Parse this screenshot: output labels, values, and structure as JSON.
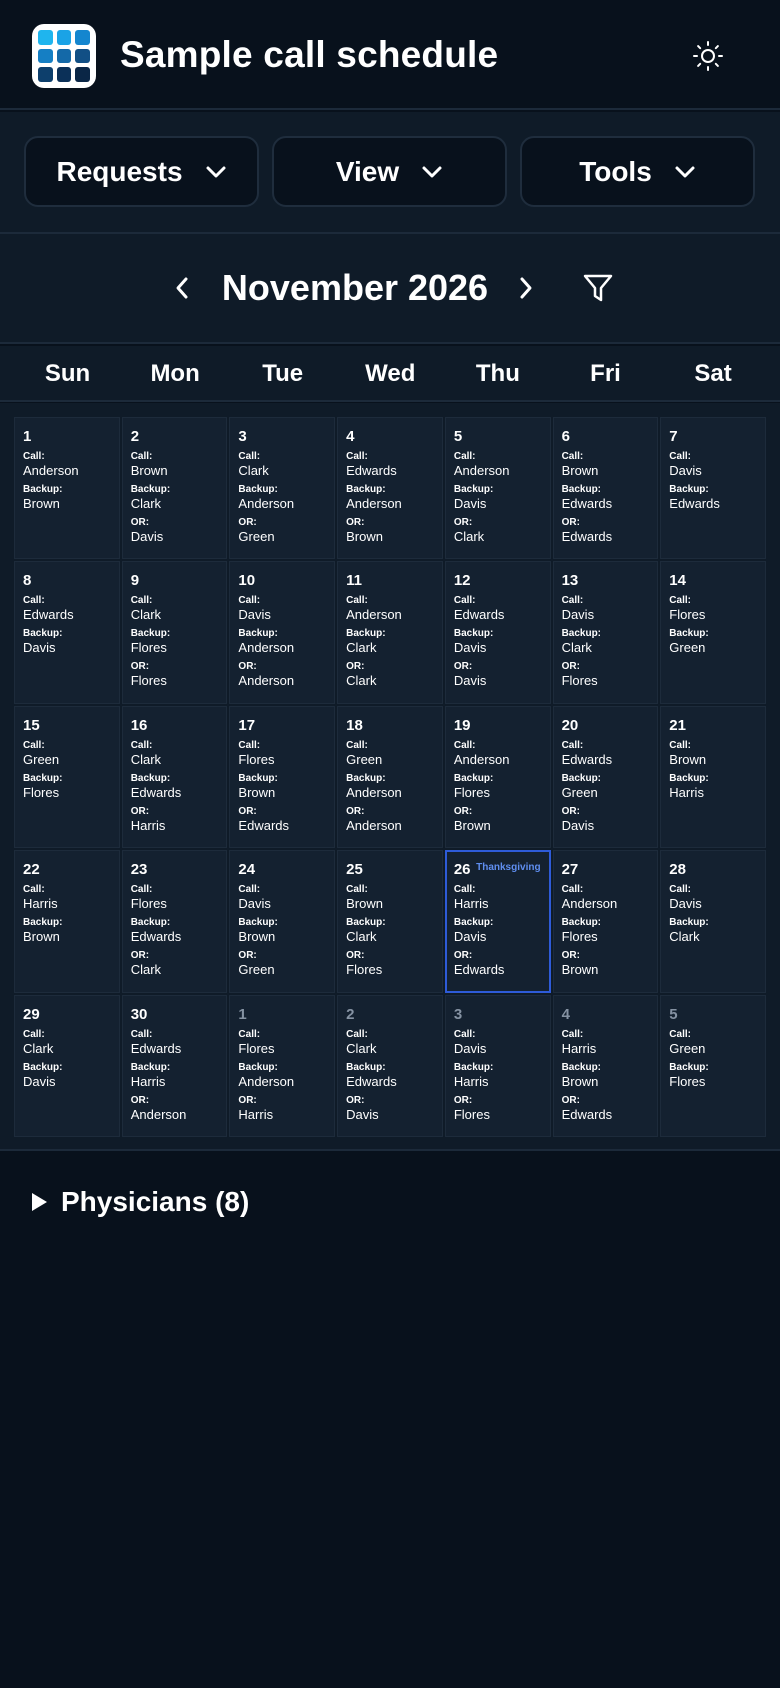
{
  "app": {
    "title": "Sample call schedule",
    "logo_colors": [
      "#1fb5ee",
      "#1aa3e6",
      "#1486cf",
      "#157fc4",
      "#1469a8",
      "#114f85",
      "#0d3f6c",
      "#0b3058",
      "#0a2646"
    ]
  },
  "toolbar": {
    "requests_label": "Requests",
    "view_label": "View",
    "tools_label": "Tools"
  },
  "calendar": {
    "month_title": "November 2026",
    "weekdays": [
      "Sun",
      "Mon",
      "Tue",
      "Wed",
      "Thu",
      "Fri",
      "Sat"
    ],
    "labels": {
      "call": "Call:",
      "backup": "Backup:",
      "or": "OR:"
    },
    "days": [
      {
        "day": "1",
        "call": "Anderson",
        "backup": "Brown"
      },
      {
        "day": "2",
        "call": "Brown",
        "backup": "Clark",
        "or": "Davis"
      },
      {
        "day": "3",
        "call": "Clark",
        "backup": "Anderson",
        "or": "Green"
      },
      {
        "day": "4",
        "call": "Edwards",
        "backup": "Anderson",
        "or": "Brown"
      },
      {
        "day": "5",
        "call": "Anderson",
        "backup": "Davis",
        "or": "Clark"
      },
      {
        "day": "6",
        "call": "Brown",
        "backup": "Edwards",
        "or": "Edwards"
      },
      {
        "day": "7",
        "call": "Davis",
        "backup": "Edwards"
      },
      {
        "day": "8",
        "call": "Edwards",
        "backup": "Davis"
      },
      {
        "day": "9",
        "call": "Clark",
        "backup": "Flores",
        "or": "Flores"
      },
      {
        "day": "10",
        "call": "Davis",
        "backup": "Anderson",
        "or": "Anderson"
      },
      {
        "day": "11",
        "call": "Anderson",
        "backup": "Clark",
        "or": "Clark"
      },
      {
        "day": "12",
        "call": "Edwards",
        "backup": "Davis",
        "or": "Davis"
      },
      {
        "day": "13",
        "call": "Davis",
        "backup": "Clark",
        "or": "Flores"
      },
      {
        "day": "14",
        "call": "Flores",
        "backup": "Green"
      },
      {
        "day": "15",
        "call": "Green",
        "backup": "Flores"
      },
      {
        "day": "16",
        "call": "Clark",
        "backup": "Edwards",
        "or": "Harris"
      },
      {
        "day": "17",
        "call": "Flores",
        "backup": "Brown",
        "or": "Edwards"
      },
      {
        "day": "18",
        "call": "Green",
        "backup": "Anderson",
        "or": "Anderson"
      },
      {
        "day": "19",
        "call": "Anderson",
        "backup": "Flores",
        "or": "Brown"
      },
      {
        "day": "20",
        "call": "Edwards",
        "backup": "Green",
        "or": "Davis"
      },
      {
        "day": "21",
        "call": "Brown",
        "backup": "Harris"
      },
      {
        "day": "22",
        "call": "Harris",
        "backup": "Brown"
      },
      {
        "day": "23",
        "call": "Flores",
        "backup": "Edwards",
        "or": "Clark"
      },
      {
        "day": "24",
        "call": "Davis",
        "backup": "Brown",
        "or": "Green"
      },
      {
        "day": "25",
        "call": "Brown",
        "backup": "Clark",
        "or": "Flores"
      },
      {
        "day": "26",
        "call": "Harris",
        "backup": "Davis",
        "or": "Edwards",
        "holiday": "Thanksgiving",
        "today": true
      },
      {
        "day": "27",
        "call": "Anderson",
        "backup": "Flores",
        "or": "Brown"
      },
      {
        "day": "28",
        "call": "Davis",
        "backup": "Clark"
      },
      {
        "day": "29",
        "call": "Clark",
        "backup": "Davis"
      },
      {
        "day": "30",
        "call": "Edwards",
        "backup": "Harris",
        "or": "Anderson"
      },
      {
        "day": "1",
        "call": "Flores",
        "backup": "Anderson",
        "or": "Harris",
        "other_month": true
      },
      {
        "day": "2",
        "call": "Clark",
        "backup": "Edwards",
        "or": "Davis",
        "other_month": true
      },
      {
        "day": "3",
        "call": "Davis",
        "backup": "Harris",
        "or": "Flores",
        "other_month": true
      },
      {
        "day": "4",
        "call": "Harris",
        "backup": "Brown",
        "or": "Edwards",
        "other_month": true
      },
      {
        "day": "5",
        "call": "Green",
        "backup": "Flores",
        "other_month": true
      }
    ]
  },
  "physicians": {
    "title": "Physicians (8)"
  },
  "colors": {
    "background": "#08111c",
    "panel": "#0f1b28",
    "cell": "#142130",
    "today_border": "#2e5bd8",
    "holiday_text": "#5f8ef0"
  }
}
